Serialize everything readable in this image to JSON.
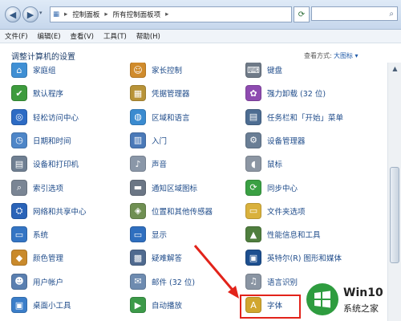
{
  "address": {
    "path": [
      "控制面板",
      "所有控制面板项"
    ],
    "search_icon": "search-icon",
    "refresh_icon": "refresh-icon"
  },
  "menu": [
    "文件(F)",
    "编辑(E)",
    "查看(V)",
    "工具(T)",
    "帮助(H)"
  ],
  "header": {
    "title": "调整计算机的设置",
    "view_by_label": "查看方式:",
    "view_by_value": "大图标 ▾"
  },
  "items": {
    "col1": [
      {
        "label": "家庭组",
        "icon": "homegroup-icon",
        "color": "#3f8fd4",
        "glyph": "⌂"
      },
      {
        "label": "默认程序",
        "icon": "default-programs-icon",
        "color": "#3d9b3d",
        "glyph": "✔"
      },
      {
        "label": "轻松访问中心",
        "icon": "ease-of-access-icon",
        "color": "#2d6bc4",
        "glyph": "◎"
      },
      {
        "label": "日期和时间",
        "icon": "date-time-icon",
        "color": "#4e86c8",
        "glyph": "◷"
      },
      {
        "label": "设备和打印机",
        "icon": "printer-icon",
        "color": "#6f7f92",
        "glyph": "▤"
      },
      {
        "label": "索引选项",
        "icon": "indexing-icon",
        "color": "#7a8594",
        "glyph": "⌕"
      },
      {
        "label": "网络和共享中心",
        "icon": "network-icon",
        "color": "#2a63b8",
        "glyph": "⛭"
      },
      {
        "label": "系统",
        "icon": "system-icon",
        "color": "#3475c4",
        "glyph": "▭"
      },
      {
        "label": "颜色管理",
        "icon": "color-management-icon",
        "color": "#c98a2c",
        "glyph": "◆"
      },
      {
        "label": "用户帐户",
        "icon": "user-accounts-icon",
        "color": "#5a7fb0",
        "glyph": "☻"
      },
      {
        "label": "桌面小工具",
        "icon": "gadgets-icon",
        "color": "#3b7ec9",
        "glyph": "▣"
      }
    ],
    "col2": [
      {
        "label": "家长控制",
        "icon": "parental-controls-icon",
        "color": "#d08b2c",
        "glyph": "☺"
      },
      {
        "label": "凭据管理器",
        "icon": "credential-manager-icon",
        "color": "#b89338",
        "glyph": "▦"
      },
      {
        "label": "区域和语言",
        "icon": "region-language-icon",
        "color": "#3a8bd0",
        "glyph": "◍"
      },
      {
        "label": "入门",
        "icon": "getting-started-icon",
        "color": "#4a79b8",
        "glyph": "▥"
      },
      {
        "label": "声音",
        "icon": "sound-icon",
        "color": "#8a97a8",
        "glyph": "♪"
      },
      {
        "label": "通知区域图标",
        "icon": "notification-area-icon",
        "color": "#6b7685",
        "glyph": "▬"
      },
      {
        "label": "位置和其他传感器",
        "icon": "location-sensors-icon",
        "color": "#6f8f52",
        "glyph": "◈"
      },
      {
        "label": "显示",
        "icon": "display-icon",
        "color": "#2f6fbf",
        "glyph": "▭"
      },
      {
        "label": "疑难解答",
        "icon": "troubleshooting-icon",
        "color": "#4f6a8f",
        "glyph": "▩"
      },
      {
        "label": "邮件 (32 位)",
        "icon": "mail-icon",
        "color": "#6e8bb0",
        "glyph": "✉"
      },
      {
        "label": "自动播放",
        "icon": "autoplay-icon",
        "color": "#3c9a49",
        "glyph": "▶"
      }
    ],
    "col3": [
      {
        "label": "键盘",
        "icon": "keyboard-icon",
        "color": "#6f7a88",
        "glyph": "⌨"
      },
      {
        "label": "强力卸载 (32 位)",
        "icon": "uninstaller-icon",
        "color": "#8e4bb0",
        "glyph": "✿"
      },
      {
        "label": "任务栏和「开始」菜单",
        "icon": "taskbar-start-icon",
        "color": "#4d6d92",
        "glyph": "▤"
      },
      {
        "label": "设备管理器",
        "icon": "device-manager-icon",
        "color": "#6a7e95",
        "glyph": "⚙"
      },
      {
        "label": "鼠标",
        "icon": "mouse-icon",
        "color": "#8c96a3",
        "glyph": "◖"
      },
      {
        "label": "同步中心",
        "icon": "sync-center-icon",
        "color": "#3aa043",
        "glyph": "⟳"
      },
      {
        "label": "文件夹选项",
        "icon": "folder-options-icon",
        "color": "#d9b13c",
        "glyph": "▭"
      },
      {
        "label": "性能信息和工具",
        "icon": "performance-icon",
        "color": "#4f7e3e",
        "glyph": "▲"
      },
      {
        "label": "英特尔(R) 图形和媒体",
        "icon": "intel-graphics-icon",
        "color": "#1d4f8f",
        "glyph": "▣"
      },
      {
        "label": "语言识别",
        "icon": "speech-recognition-icon",
        "color": "#8a95a3",
        "glyph": "♫"
      },
      {
        "label": "字体",
        "icon": "fonts-icon",
        "color": "#d1a62e",
        "glyph": "A"
      }
    ]
  },
  "watermark": {
    "brand": "Win10",
    "subtitle": "系统之家"
  },
  "colors": {
    "link": "#1e4b8a",
    "highlight": "#e2231a",
    "watermark_green": "#2e9c3f"
  }
}
